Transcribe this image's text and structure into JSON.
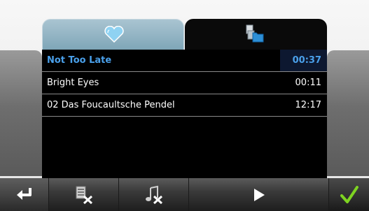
{
  "playlist": {
    "tabs": [
      {
        "icon": "heart-icon"
      },
      {
        "icon": "file-browser-icon"
      }
    ],
    "tracks": [
      {
        "title": "Not Too Late",
        "duration": "00:37",
        "selected": true
      },
      {
        "title": "Bright Eyes",
        "duration": "00:11"
      },
      {
        "title": "02 Das Foucaultsche Pendel",
        "duration": "12:17"
      }
    ]
  },
  "toolbar": {
    "buttons": [
      {
        "icon": "back-arrow-icon"
      },
      {
        "icon": "delete-list-icon"
      },
      {
        "icon": "delete-track-icon"
      },
      {
        "icon": "play-icon"
      },
      {
        "icon": "checkmark-icon"
      }
    ]
  },
  "colors": {
    "selected_text": "#4aa0ea",
    "list_background": "#000000",
    "toolbar": "#2c2c2c",
    "check": "#7ed321"
  }
}
